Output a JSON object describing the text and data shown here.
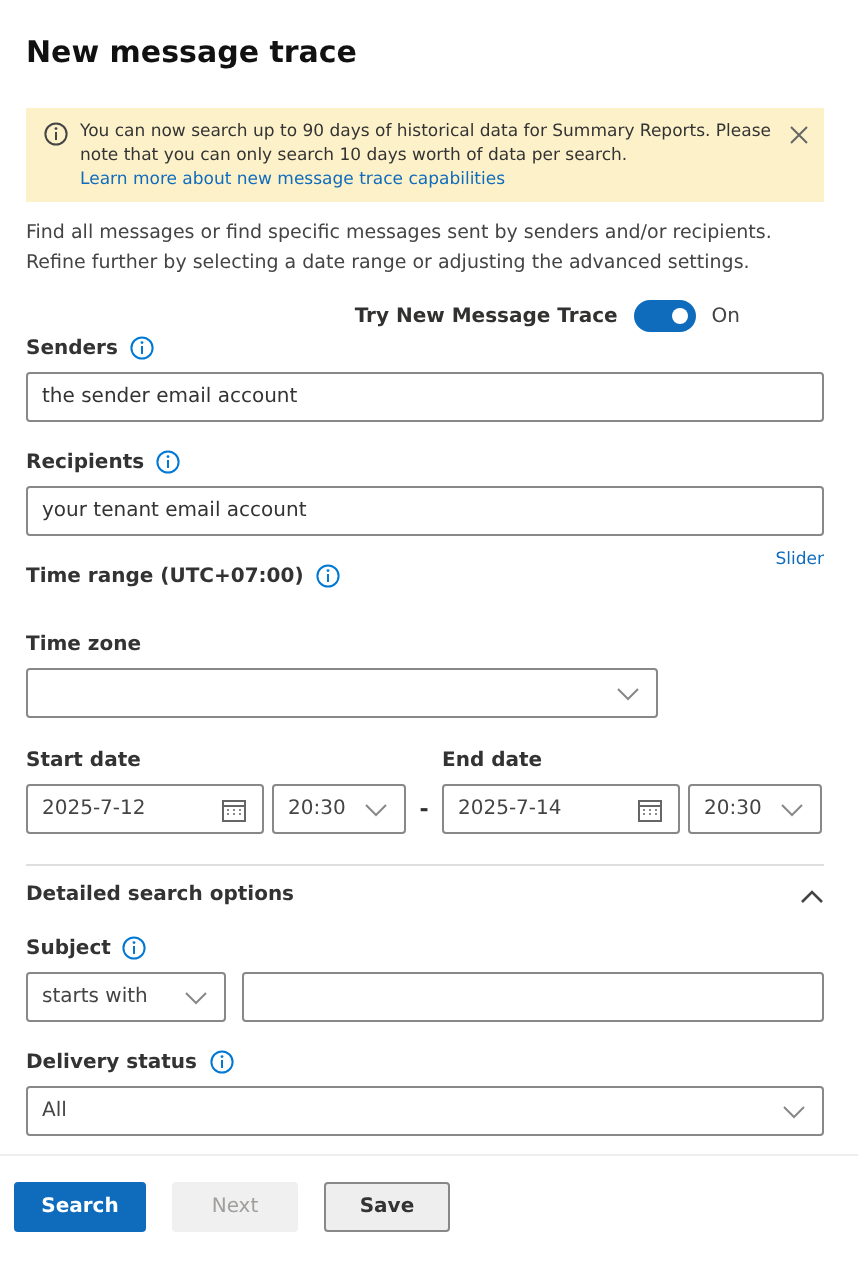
{
  "title": "New message trace",
  "banner": {
    "text": "You can now search up to 90 days of historical data for Summary Reports. Please note that you can only search 10 days worth of data per search.",
    "link": "Learn more about new message trace capabilities"
  },
  "description": "Find all messages or find specific messages sent by senders and/or recipients. Refine further by selecting a date range or adjusting the advanced settings.",
  "toggle": {
    "label": "Try New Message Trace",
    "on": true,
    "state_text": "On"
  },
  "senders": {
    "label": "Senders",
    "value": "the sender email account"
  },
  "recipients": {
    "label": "Recipients",
    "value": "your tenant email account"
  },
  "time_range": {
    "label": "Time range (UTC+07:00)",
    "link": "Slider"
  },
  "time_zone": {
    "label": "Time zone"
  },
  "start": {
    "label": "Start date",
    "date": "2025-7-12",
    "time": "20:30"
  },
  "separator": "-",
  "end": {
    "label": "End date",
    "date": "2025-7-14",
    "time": "20:30"
  },
  "detailed": {
    "label": "Detailed search options",
    "expanded": true
  },
  "subject": {
    "label": "Subject",
    "operator": "starts with"
  },
  "delivery_status": {
    "label": "Delivery status",
    "value": "All"
  },
  "buttons": [
    {
      "label": "Search",
      "kind": "primary",
      "disabled": false
    },
    {
      "label": "Next",
      "kind": "default",
      "disabled": true
    },
    {
      "label": "Save",
      "kind": "default",
      "disabled": false
    }
  ]
}
